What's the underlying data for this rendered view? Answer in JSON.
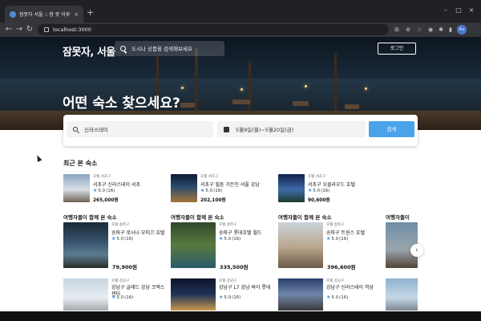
{
  "browser": {
    "tab_title": "잠못자 서울 :: 잠 못 이루는 밤",
    "tab_close": "×",
    "new_tab": "+",
    "url": "localhost:3000",
    "profile": "Pro"
  },
  "header": {
    "logo": "잠못자, 서울",
    "search_placeholder": "도시나 상품을 검색해보세요",
    "login_label": "로그인",
    "headline": "어떤 숙소 찾으세요?"
  },
  "search_card": {
    "destination": "신라스테이",
    "dates": "5월9일(월)~5월20일(금)",
    "button_label": "검색"
  },
  "recent": {
    "title": "최근 본 숙소",
    "items": [
      {
        "category": "호텔 서초구",
        "name": "서초구 신라스테이 서초",
        "rating": "5.0",
        "reviews": "(16)",
        "price": "265,000원"
      },
      {
        "category": "호텔 서초구",
        "name": "서초구 힐튼 가든인 서울 강남",
        "rating": "5.0",
        "reviews": "(16)",
        "price": "202,100원"
      },
      {
        "category": "호텔 서초구",
        "name": "서초구 오클라우드 호텔",
        "rating": "5.0",
        "reviews": "(16)",
        "price": "90,600원"
      }
    ]
  },
  "together": {
    "title": "여행자들이 함께 본 숙소",
    "partial_title": "여행자들이",
    "items": [
      {
        "category": "호텔 송파구",
        "name": "송파구 로사나 부띠끄 호텔",
        "rating": "5.0",
        "reviews": "(16)",
        "price": "79,900원"
      },
      {
        "category": "호텔 송파구",
        "name": "송파구 롯데호텔 월드",
        "rating": "5.0",
        "reviews": "(16)",
        "price": "335,500원"
      },
      {
        "category": "호텔 송파구",
        "name": "송파구 트윈스 호텔",
        "rating": "5.0",
        "reviews": "(16)",
        "price": "396,600원"
      }
    ]
  },
  "bottom_row": {
    "items": [
      {
        "category": "호텔 강남구",
        "name": "강남구 글래드 강남 코엑스 센터",
        "rating": "5.0",
        "reviews": "(16)"
      },
      {
        "category": "호텔 강남구",
        "name": "강남구 L7 강남 바이 롯데",
        "rating": "5.0",
        "reviews": "(16)"
      },
      {
        "category": "호텔 강남구",
        "name": "강남구 신라스테이 역삼",
        "rating": "5.0",
        "reviews": "(16)"
      }
    ]
  },
  "icons": {
    "star": "★",
    "next": "›"
  },
  "colors": {
    "accent": "#4aa3ea",
    "star": "#3b8de0"
  }
}
